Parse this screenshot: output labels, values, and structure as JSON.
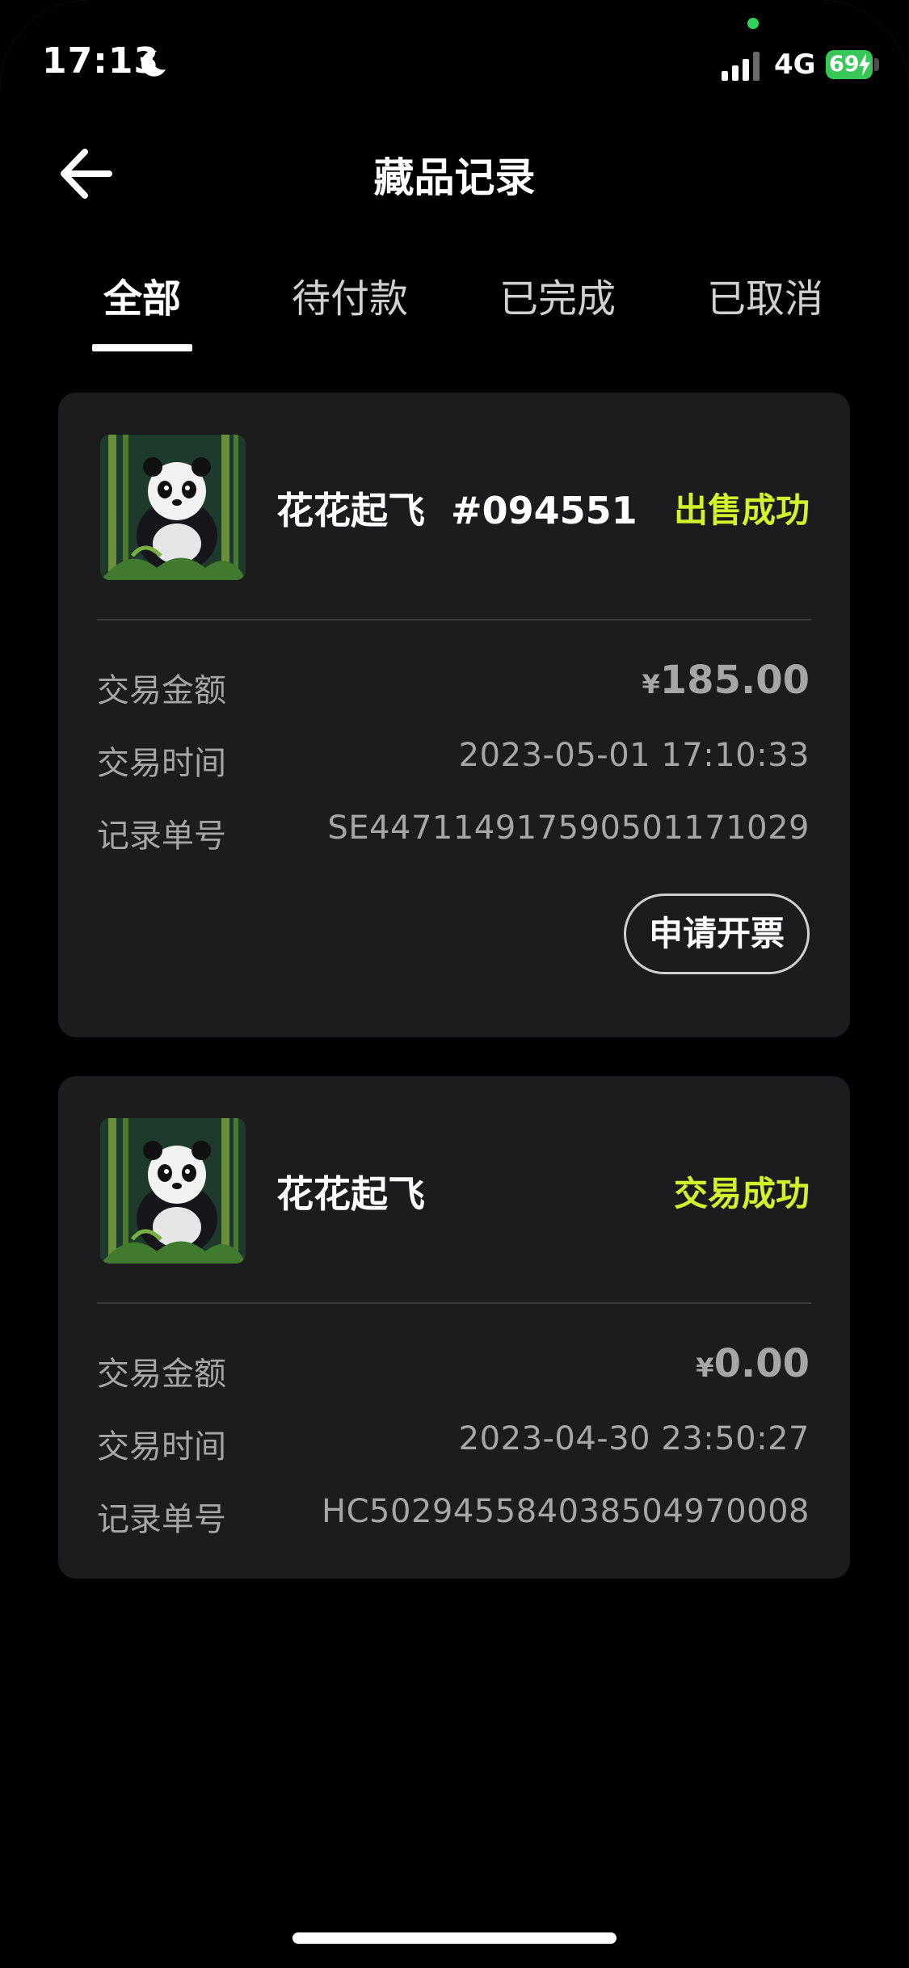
{
  "status_bar": {
    "time": "17:13",
    "network": "4G",
    "battery": "69"
  },
  "header": {
    "title": "藏品记录"
  },
  "tabs": [
    {
      "label": "全部",
      "active": true
    },
    {
      "label": "待付款",
      "active": false
    },
    {
      "label": "已完成",
      "active": false
    },
    {
      "label": "已取消",
      "active": false
    }
  ],
  "records": [
    {
      "name": "花花起飞  #094551",
      "status": "出售成功",
      "amount_label": "交易金额",
      "currency": "¥",
      "amount": "185.00",
      "time_label": "交易时间",
      "time": "2023-05-01 17:10:33",
      "order_label": "记录单号",
      "order_no": "SE447114917590501171029",
      "action": "申请开票"
    },
    {
      "name": "花花起飞",
      "status": "交易成功",
      "amount_label": "交易金额",
      "currency": "¥",
      "amount": "0.00",
      "time_label": "交易时间",
      "time": "2023-04-30 23:50:27",
      "order_label": "记录单号",
      "order_no": "HC502945584038504970008"
    }
  ],
  "colors": {
    "background": "#000000",
    "card": "#1c1c1e",
    "status_accent": "#d3f22b",
    "secondary_text": "#a6a6a8"
  },
  "icons": {
    "back": "arrow-left-icon",
    "moon": "moon-icon",
    "signal": "signal-icon",
    "battery": "battery-icon",
    "thumbnail": "panda-thumbnail"
  }
}
